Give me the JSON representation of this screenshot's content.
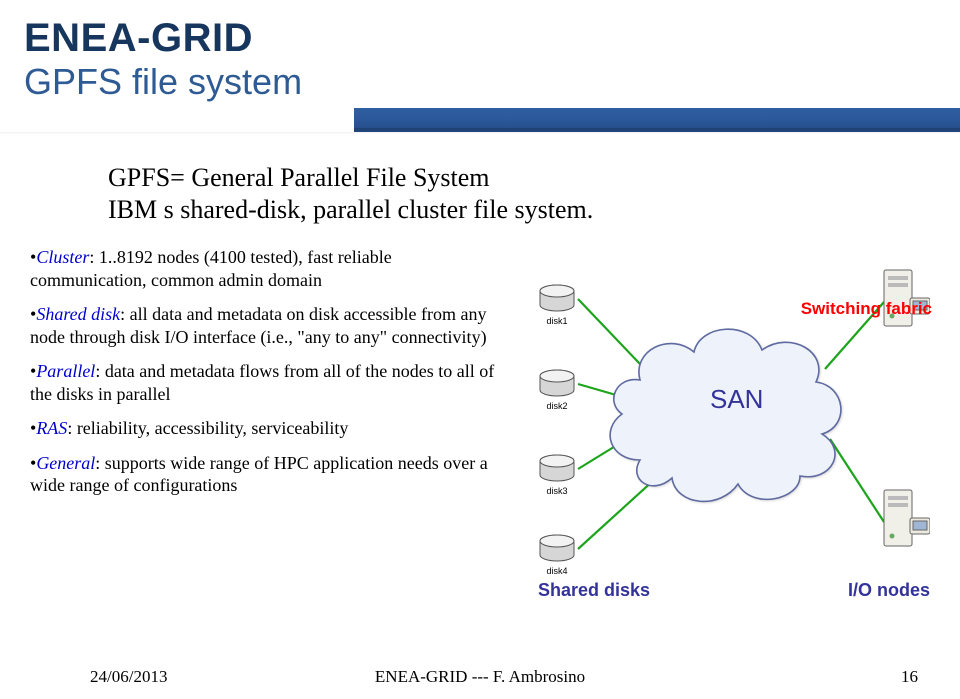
{
  "header": {
    "title": "ENEA-GRID",
    "subtitle": "GPFS file system"
  },
  "intro": {
    "line1": "GPFS= General Parallel File System",
    "line2": "IBM s shared-disk, parallel cluster file system."
  },
  "bullets": [
    {
      "keyword": "Cluster",
      "rest": ": 1..8192 nodes (4100 tested), fast reliable communication, common admin domain"
    },
    {
      "keyword": "Shared disk",
      "rest": ": all data and metadata on disk accessible from any node through disk I/O interface (i.e., \"any to any\" connectivity)"
    },
    {
      "keyword": "Parallel",
      "rest": ": data and metadata flows from all of the nodes to all of the disks in parallel"
    },
    {
      "keyword": "RAS",
      "rest": ": reliability, accessibility, serviceability"
    },
    {
      "keyword": "General",
      "rest": ": supports wide range of HPC application needs over a wide range of configurations"
    }
  ],
  "diagram": {
    "san": "SAN",
    "switching": "Switching fabric",
    "shared_disks": "Shared disks",
    "io_nodes": "I/O nodes",
    "disk_labels": [
      "disk1",
      "disk2",
      "disk3",
      "disk4"
    ]
  },
  "footer": {
    "date": "24/06/2013",
    "center": "ENEA-GRID --- F. Ambrosino",
    "page": "16"
  }
}
